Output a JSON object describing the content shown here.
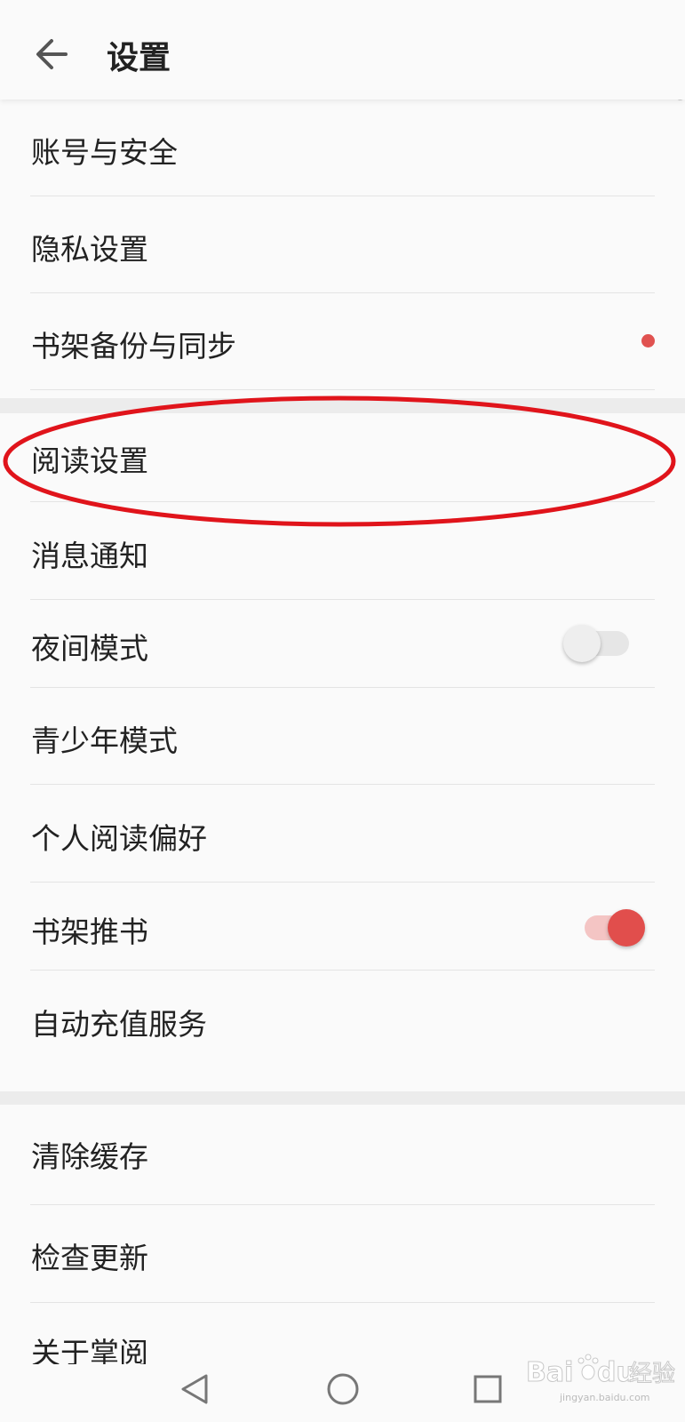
{
  "header": {
    "title": "设置"
  },
  "groups": [
    {
      "items": [
        {
          "label": "账号与安全"
        },
        {
          "label": "隐私设置"
        },
        {
          "label": "书架备份与同步",
          "badge": "red-dot"
        }
      ]
    },
    {
      "items": [
        {
          "label": "阅读设置",
          "highlighted": true
        },
        {
          "label": "消息通知"
        },
        {
          "label": "夜间模式",
          "toggle": false
        },
        {
          "label": "青少年模式"
        },
        {
          "label": "个人阅读偏好"
        },
        {
          "label": "书架推书",
          "toggle": true
        },
        {
          "label": "自动充值服务"
        }
      ]
    },
    {
      "items": [
        {
          "label": "清除缓存"
        },
        {
          "label": "检查更新"
        },
        {
          "label": "关于掌阅"
        }
      ]
    }
  ],
  "colors": {
    "accent": "#e14e4c",
    "annotation": "#e0141b",
    "section_gap": "#ececec"
  },
  "navbar": {
    "icons": [
      "back-triangle-icon",
      "home-circle-icon",
      "recents-square-icon"
    ]
  },
  "watermark": {
    "brand": "Bai",
    "brand2": "du",
    "cn": "经验",
    "url": "jingyan.baidu.com"
  }
}
